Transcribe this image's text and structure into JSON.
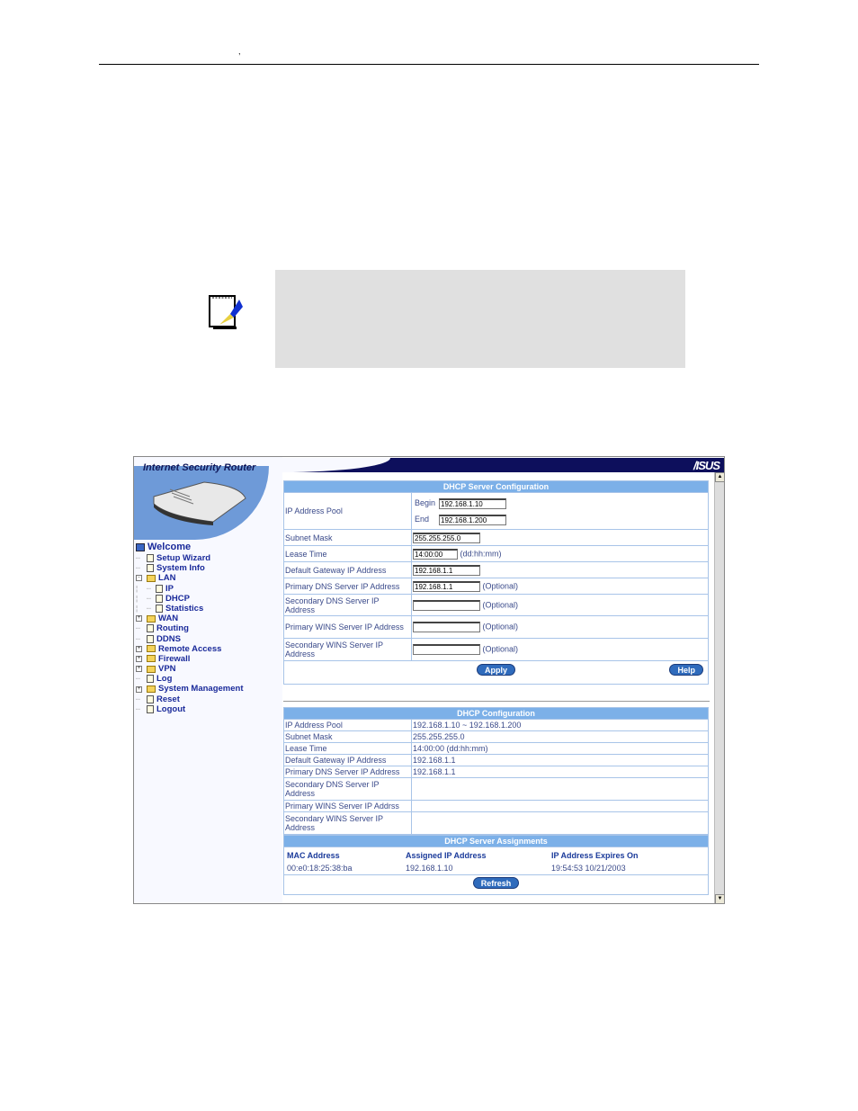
{
  "doc": {
    "header_mark": ","
  },
  "app": {
    "title": "Internet Security Router",
    "brand": "/ISUS"
  },
  "sidebar": {
    "items": [
      {
        "label": "Welcome",
        "icon": "computer-icon",
        "level": 0
      },
      {
        "label": "Setup Wizard",
        "icon": "document-icon",
        "level": 1
      },
      {
        "label": "System Info",
        "icon": "document-icon",
        "level": 1
      },
      {
        "label": "LAN",
        "icon": "folder-open-icon",
        "level": 1,
        "expander": "-"
      },
      {
        "label": "IP",
        "icon": "document-icon",
        "level": 2
      },
      {
        "label": "DHCP",
        "icon": "document-icon",
        "level": 2
      },
      {
        "label": "Statistics",
        "icon": "document-icon",
        "level": 2
      },
      {
        "label": "WAN",
        "icon": "folder-icon",
        "level": 1,
        "expander": "+"
      },
      {
        "label": "Routing",
        "icon": "document-icon",
        "level": 1
      },
      {
        "label": "DDNS",
        "icon": "document-icon",
        "level": 1
      },
      {
        "label": "Remote Access",
        "icon": "folder-icon",
        "level": 1,
        "expander": "+"
      },
      {
        "label": "Firewall",
        "icon": "folder-icon",
        "level": 1,
        "expander": "+"
      },
      {
        "label": "VPN",
        "icon": "folder-icon",
        "level": 1,
        "expander": "+"
      },
      {
        "label": "Log",
        "icon": "document-icon",
        "level": 1
      },
      {
        "label": "System Management",
        "icon": "folder-icon",
        "level": 1,
        "expander": "+"
      },
      {
        "label": "Reset",
        "icon": "document-icon",
        "level": 1
      },
      {
        "label": "Logout",
        "icon": "document-icon",
        "level": 1
      }
    ]
  },
  "server_config": {
    "title": "DHCP Server Configuration",
    "pool_label": "IP Address Pool",
    "begin_label": "Begin",
    "begin_value": "192.168.1.10",
    "end_label": "End",
    "end_value": "192.168.1.200",
    "subnet_label": "Subnet Mask",
    "subnet_value": "255.255.255.0",
    "lease_label": "Lease Time",
    "lease_value": "14:00:00",
    "lease_hint": "(dd:hh:mm)",
    "gateway_label": "Default Gateway IP Address",
    "gateway_value": "192.168.1.1",
    "pdns_label": "Primary DNS Server IP Address",
    "pdns_value": "192.168.1.1",
    "sdns_label": "Secondary DNS Server IP Address",
    "sdns_value": "",
    "pwins_label": "Primary WINS Server IP Address",
    "pwins_value": "",
    "swins_label": "Secondary WINS Server IP Address",
    "swins_value": "",
    "optional": "(Optional)",
    "apply": "Apply",
    "help": "Help"
  },
  "dhcp_config": {
    "title": "DHCP Configuration",
    "rows": [
      {
        "label": "IP Address Pool",
        "value": "192.168.1.10 ~ 192.168.1.200"
      },
      {
        "label": "Subnet Mask",
        "value": "255.255.255.0"
      },
      {
        "label": "Lease Time",
        "value": "14:00:00 (dd:hh:mm)"
      },
      {
        "label": "Default Gateway IP Address",
        "value": "192.168.1.1"
      },
      {
        "label": "Primary DNS Server IP Address",
        "value": "192.168.1.1"
      },
      {
        "label": "Secondary DNS Server IP Address",
        "value": ""
      },
      {
        "label": "Primary WINS Server IP Addrss",
        "value": ""
      },
      {
        "label": "Secondary WINS Server IP Address",
        "value": ""
      }
    ]
  },
  "assignments": {
    "title": "DHCP Server Assignments",
    "columns": [
      "MAC Address",
      "Assigned IP Address",
      "IP Address Expires On"
    ],
    "rows": [
      [
        "00:e0:18:25:38:ba",
        "192.168.1.10",
        "19:54:53 10/21/2003"
      ]
    ],
    "refresh": "Refresh"
  }
}
